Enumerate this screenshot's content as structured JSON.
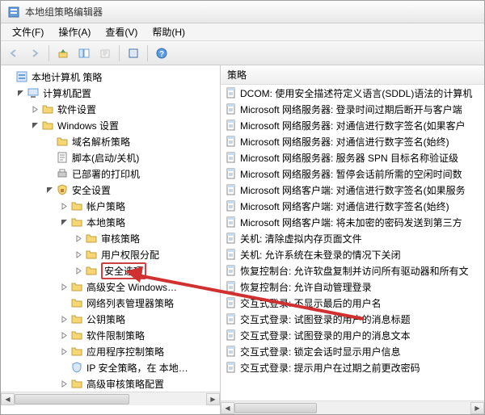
{
  "window": {
    "title": "本地组策略编辑器"
  },
  "menu": {
    "file": "文件(F)",
    "action": "操作(A)",
    "view": "查看(V)",
    "help": "帮助(H)"
  },
  "tree": {
    "root": "本地计算机 策略",
    "computer_config": "计算机配置",
    "software_settings": "软件设置",
    "windows_settings": "Windows 设置",
    "name_resolution": "域名解析策略",
    "scripts": "脚本(启动/关机)",
    "deployed_printers": "已部署的打印机",
    "security_settings": "安全设置",
    "account_policies": "帐户策略",
    "local_policies": "本地策略",
    "audit_policy": "审核策略",
    "user_rights": "用户权限分配",
    "security_options": "安全选项",
    "windows_firewall": "高级安全 Windows…",
    "network_list": "网络列表管理器策略",
    "public_key": "公钥策略",
    "software_restriction": "软件限制策略",
    "app_control": "应用程序控制策略",
    "ip_security": "IP 安全策略，在 本地…",
    "advanced_audit": "高级审核策略配置"
  },
  "list": {
    "header": "策略",
    "items": [
      "DCOM: 使用安全描述符定义语言(SDDL)语法的计算机",
      "Microsoft 网络服务器: 登录时间过期后断开与客户端",
      "Microsoft 网络服务器: 对通信进行数字签名(如果客户",
      "Microsoft 网络服务器: 对通信进行数字签名(始终)",
      "Microsoft 网络服务器: 服务器 SPN 目标名称验证级",
      "Microsoft 网络服务器: 暂停会话前所需的空闲时间数",
      "Microsoft 网络客户端: 对通信进行数字签名(如果服务",
      "Microsoft 网络客户端: 对通信进行数字签名(始终)",
      "Microsoft 网络客户端: 将未加密的密码发送到第三方",
      "关机: 清除虚拟内存页面文件",
      "关机: 允许系统在未登录的情况下关闭",
      "恢复控制台: 允许软盘复制并访问所有驱动器和所有文",
      "恢复控制台: 允许自动管理登录",
      "交互式登录: 不显示最后的用户名",
      "交互式登录: 试图登录的用户的消息标题",
      "交互式登录: 试图登录的用户的消息文本",
      "交互式登录: 锁定会话时显示用户信息",
      "交互式登录: 提示用户在过期之前更改密码"
    ]
  }
}
